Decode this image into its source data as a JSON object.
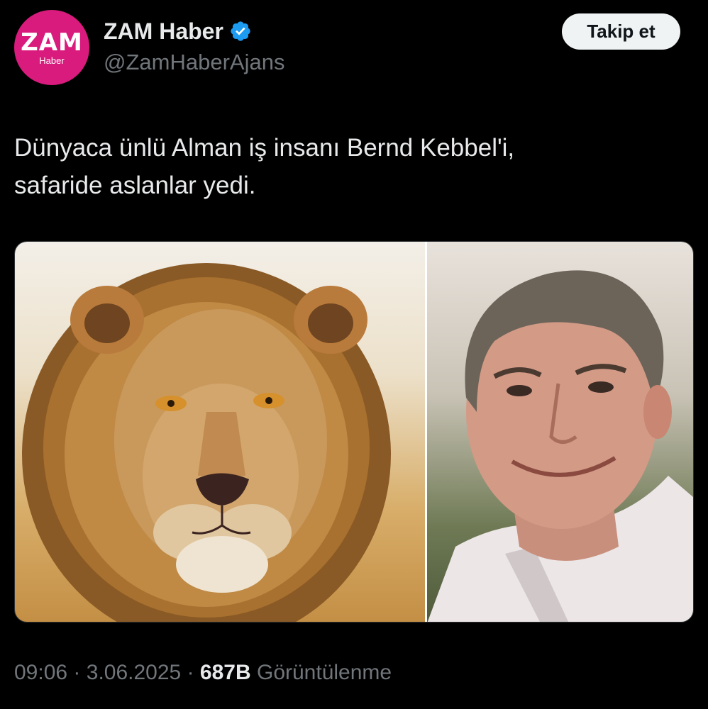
{
  "author": {
    "avatar_text": "ZAM",
    "avatar_subtext": "Haber",
    "display_name": "ZAM Haber",
    "handle": "@ZamHaberAjans",
    "verified_icon": "verified-badge-icon",
    "avatar_color": "#d81b7c",
    "verified_color": "#1d9bf0"
  },
  "follow_button": {
    "label": "Takip et"
  },
  "tweet": {
    "lines": [
      "Dünyaca ünlü Alman iş insanı Bernd Kebbel'i,",
      "safaride aslanlar yedi."
    ]
  },
  "media": {
    "images": [
      {
        "name": "lion-photo"
      },
      {
        "name": "man-photo"
      }
    ]
  },
  "meta": {
    "time": "09:06",
    "separator": "·",
    "date": "3.06.2025",
    "views_count": "687B",
    "views_label": "Görüntülenme"
  }
}
